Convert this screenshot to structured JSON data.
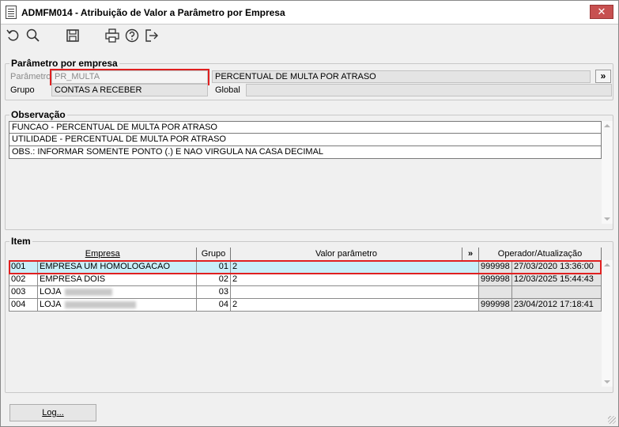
{
  "window": {
    "title": "ADMFM014 - Atribuição de Valor a Parâmetro por Empresa",
    "close_label": "✕"
  },
  "toolbar": {
    "icons": [
      "undo-icon",
      "search-icon",
      "save-icon",
      "print-icon",
      "help-icon",
      "exit-icon"
    ]
  },
  "parametro_section": {
    "legend": "Parâmetro por empresa",
    "parametro_label": "Parâmetro",
    "parametro_value": "PR_MULTA",
    "parametro_desc": "PERCENTUAL DE MULTA POR ATRASO",
    "more_label": "»",
    "grupo_label": "Grupo",
    "grupo_value": "CONTAS A RECEBER",
    "global_label": "Global",
    "global_value": ""
  },
  "observacao_section": {
    "legend": "Observação",
    "lines": [
      "FUNCAO - PERCENTUAL DE MULTA POR ATRASO",
      "UTILIDADE - PERCENTUAL DE MULTA POR ATRASO",
      "OBS.: INFORMAR SOMENTE PONTO (.) E NAO VIRGULA NA CASA DECIMAL"
    ]
  },
  "item_section": {
    "legend": "Item",
    "columns": {
      "empresa": "Empresa",
      "grupo": "Grupo",
      "valor": "Valor parâmetro",
      "more": "»",
      "operador": "Operador/Atualização"
    },
    "rows": [
      {
        "code": "001",
        "name": "EMPRESA UM HOMOLOGACAO",
        "grupo": "01",
        "valor": "2",
        "operador": "999998",
        "data": "27/03/2020 13:36:00"
      },
      {
        "code": "002",
        "name": "EMPRESA DOIS",
        "grupo": "02",
        "valor": "2",
        "operador": "999998",
        "data": "12/03/2025 15:44:43"
      },
      {
        "code": "003",
        "name": "LOJA",
        "grupo": "03",
        "valor": "",
        "operador": "",
        "data": ""
      },
      {
        "code": "004",
        "name": "LOJA",
        "grupo": "04",
        "valor": "2",
        "operador": "999998",
        "data": "23/04/2012 17:18:41"
      }
    ]
  },
  "footer": {
    "log_button": "Log..."
  },
  "colors": {
    "highlight_border": "#e02020",
    "selected_row": "#c9eef8",
    "close_button": "#c75050"
  }
}
